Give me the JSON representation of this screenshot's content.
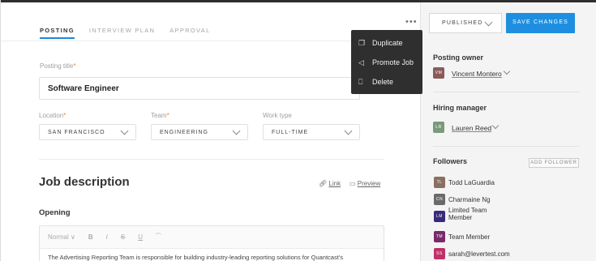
{
  "tabs": [
    {
      "label": "POSTING"
    },
    {
      "label": "INTERVIEW PLAN"
    },
    {
      "label": "APPROVAL"
    }
  ],
  "more_label": "•••",
  "header_buttons": {
    "published_label": "PUBLISHED",
    "save_label": "SAVE CHANGES"
  },
  "colors": {
    "accent": "#1e8fe0",
    "required": "#f08030",
    "menu_bg": "#2f2f2f"
  },
  "menu": {
    "items": [
      {
        "label": "Duplicate",
        "icon": "duplicate-icon"
      },
      {
        "label": "Promote Job",
        "icon": "megaphone-icon"
      },
      {
        "label": "Delete",
        "icon": "trash-icon"
      }
    ]
  },
  "form": {
    "posting_title_label": "Posting title",
    "posting_title_required": "*",
    "posting_title_value": "Software Engineer",
    "location_label": "Location",
    "location_required": "*",
    "location_value": "SAN FRANCISCO",
    "team_label": "Team",
    "team_required": "*",
    "team_value": "ENGINEERING",
    "work_type_label": "Work type",
    "work_type_value": "FULL-TIME"
  },
  "job_description": {
    "title": "Job description",
    "link_label": "Link",
    "preview_label": "Preview",
    "opening_label": "Opening",
    "toolbar": {
      "style_label": "Normal",
      "bold": "B",
      "italic": "I",
      "strike": "S",
      "underline": "U"
    },
    "text": "The Advertising Reporting Team is responsible for building industry-leading reporting solutions for Quantcast's"
  },
  "sidebar": {
    "posting_owner_title": "Posting owner",
    "posting_owner": {
      "initials": "VM",
      "name": "Vincent Montero"
    },
    "hiring_manager_title": "Hiring manager",
    "hiring_manager": {
      "initials": "LR",
      "name": "Lauren Reed"
    },
    "followers_title": "Followers",
    "add_follower_label": "ADD FOLLOWER",
    "followers": [
      {
        "initials": "TL",
        "name": "Todd LaGuardia",
        "color": "#8a7060"
      },
      {
        "initials": "CN",
        "name": "Charmaine Ng",
        "color": "#6a6a6a"
      },
      {
        "initials": "LM",
        "name": "Limited Team Member",
        "color": "#3a2a7a"
      },
      {
        "initials": "TM",
        "name": "Team Member",
        "color": "#7a2a6a"
      },
      {
        "initials": "SS",
        "name": "sarah@levertest.com",
        "color": "#c0306a"
      }
    ]
  }
}
